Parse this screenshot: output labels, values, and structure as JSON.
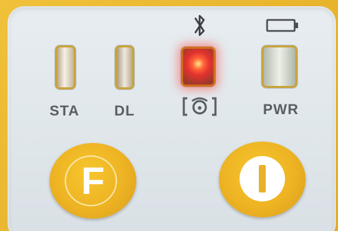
{
  "panel": {
    "indicators": [
      {
        "id": "sta",
        "label": "STA",
        "state": "off"
      },
      {
        "id": "dl",
        "label": "DL",
        "state": "off"
      },
      {
        "id": "bluetooth",
        "label": "",
        "state": "on",
        "color": "#ff4a3a"
      },
      {
        "id": "pwr",
        "label": "PWR",
        "state": "off"
      }
    ],
    "icons": {
      "bluetooth": "bluetooth-icon",
      "radio": "radio-icon",
      "battery": "battery-icon"
    },
    "buttons": {
      "function_label": "F",
      "power_symbol": "I"
    },
    "colors": {
      "housing": "#e9b62a",
      "panel": "#e3e9ed",
      "label": "#5a5e64",
      "button": "#edb323"
    }
  }
}
